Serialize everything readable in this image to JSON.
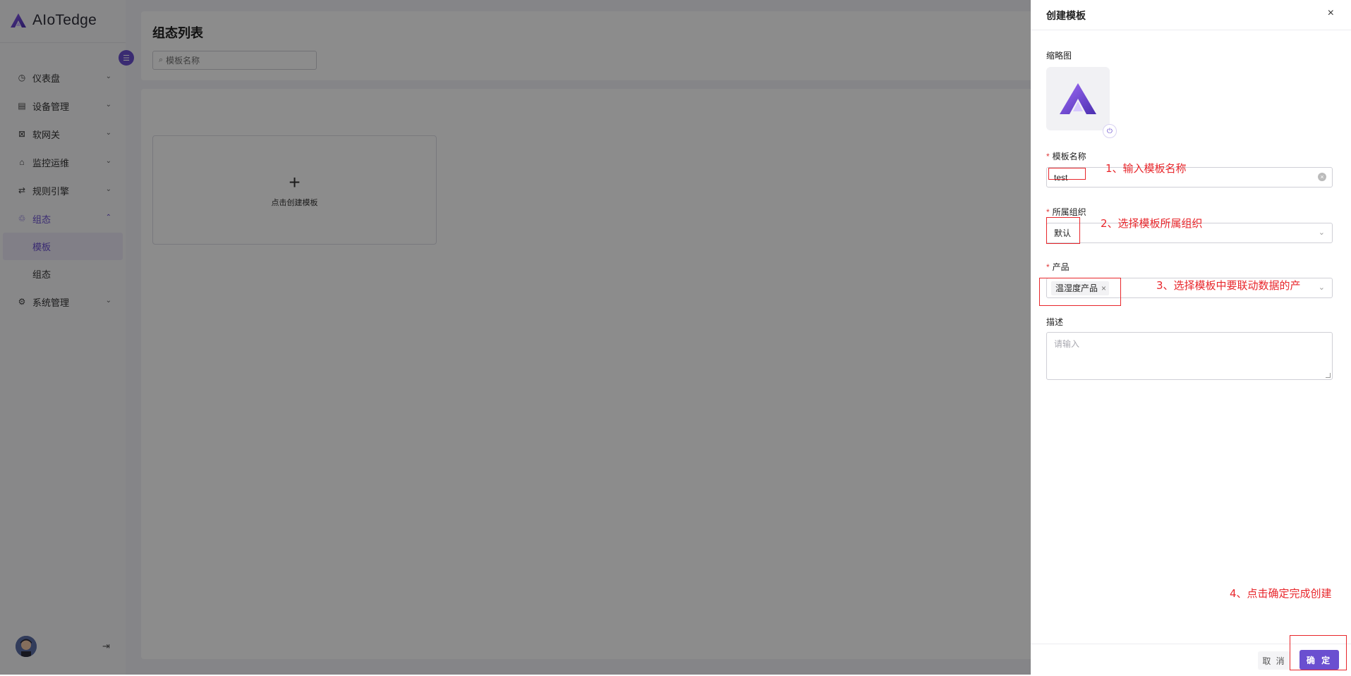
{
  "app": {
    "brand": "AIoTedge"
  },
  "sidebar": {
    "items": [
      {
        "label": "仪表盘",
        "icon": "dashboard-icon"
      },
      {
        "label": "设备管理",
        "icon": "device-icon"
      },
      {
        "label": "软网关",
        "icon": "gateway-icon"
      },
      {
        "label": "监控运维",
        "icon": "monitor-icon"
      },
      {
        "label": "规则引擎",
        "icon": "rule-icon"
      },
      {
        "label": "组态",
        "icon": "config-icon",
        "expanded": true
      },
      {
        "label": "系统管理",
        "icon": "settings-icon"
      }
    ],
    "sub_items": [
      {
        "label": "模板",
        "selected": true
      },
      {
        "label": "组态",
        "selected": false
      }
    ]
  },
  "page": {
    "title": "组态列表",
    "search_placeholder": "模板名称",
    "create_card_label": "点击创建模板"
  },
  "drawer": {
    "title": "创建模板",
    "thumbnail_label": "缩略图",
    "name_label": "模板名称",
    "name_value": "test",
    "org_label": "所属组织",
    "org_value": "默认",
    "product_label": "产品",
    "product_tags": [
      "温湿度产品"
    ],
    "desc_label": "描述",
    "desc_placeholder": "请输入",
    "cancel_label": "取 消",
    "ok_label": "确 定"
  },
  "annotations": {
    "step1": "1、输入模板名称",
    "step2": "2、选择模板所属组织",
    "step3": "3、选择模板中要联动数据的产",
    "step4": "4、点击确定完成创建"
  },
  "colors": {
    "accent": "#6a4fd0",
    "annotation": "#e8262b"
  }
}
